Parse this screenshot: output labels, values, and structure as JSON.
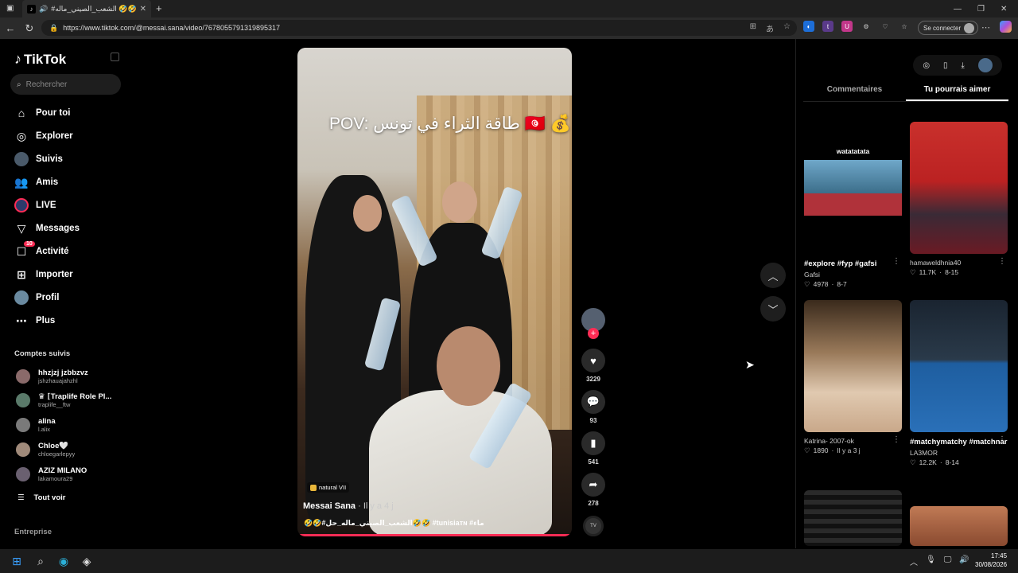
{
  "browser": {
    "tab_title": "#الشعب_الصيني_ماله 🤣🤣🤣",
    "url": "https://www.tiktok.com/@messai.sana/video/7678055791319895317",
    "connect_label": "Se connecter"
  },
  "sidebar": {
    "logo": "TikTok",
    "search_placeholder": "Rechercher",
    "nav": [
      {
        "label": "Pour toi",
        "icon": "home-icon"
      },
      {
        "label": "Explorer",
        "icon": "compass-icon"
      },
      {
        "label": "Suivis",
        "icon": "following-icon"
      },
      {
        "label": "Amis",
        "icon": "friends-icon"
      },
      {
        "label": "LIVE",
        "icon": "live-icon"
      },
      {
        "label": "Messages",
        "icon": "send-icon"
      },
      {
        "label": "Activité",
        "icon": "activity-icon",
        "badge": "10"
      },
      {
        "label": "Importer",
        "icon": "plus-square-icon"
      },
      {
        "label": "Profil",
        "icon": "profile-icon"
      },
      {
        "label": "Plus",
        "icon": "more-icon"
      }
    ],
    "followed_title": "Comptes suivis",
    "followed": [
      {
        "name": "hhzjzj jzbbzvz",
        "handle": "jshzhauajahzhl"
      },
      {
        "name": "♛ ⟦Traplife Role Pl...",
        "handle": "traplife__ftw"
      },
      {
        "name": "alina",
        "handle": "l.alix"
      },
      {
        "name": "Chloe🤍",
        "handle": "chloegarlepyy"
      },
      {
        "name": "AZIZ MILANO",
        "handle": "lakamoura29"
      }
    ],
    "see_all": "Tout voir",
    "enterprise": "Entreprise"
  },
  "video": {
    "overlay_text": "POV: طاقة الثراء في تونس 🇹🇳 💰",
    "music": "natural VII",
    "author": "Messai Sana",
    "time": " · Il y a 4 j",
    "caption": "🤣🤣#الشعب_الصيني_ماله_حل🤣🤣 #tunisiaᴛɴ #ماء",
    "likes": "3229",
    "comments": "93",
    "saves": "541",
    "shares": "278"
  },
  "right_panel": {
    "tabs": [
      "Commentaires",
      "Tu pourrais aimer"
    ],
    "active_tab": 1,
    "cards": [
      {
        "thumb_text": "watatatata",
        "title": "#explore #fyp #gafsi",
        "user": "Gafsi",
        "likes": "4978",
        "date": "8-7"
      },
      {
        "title": "",
        "user": "hamaweldhnia40",
        "likes": "11.7K",
        "date": "8-15"
      },
      {
        "title": "",
        "user": "Katrina- 2007-ok",
        "likes": "1890",
        "date": "Il y a 3 j"
      },
      {
        "title": "#matchymatchy #matchnar",
        "user": "LA3MOR",
        "likes": "12.2K",
        "date": "8-14"
      }
    ]
  },
  "taskbar": {
    "time": "17:45",
    "date": "30/08/2026"
  },
  "colors": {
    "accent": "#fe2c55",
    "background": "#000000"
  }
}
